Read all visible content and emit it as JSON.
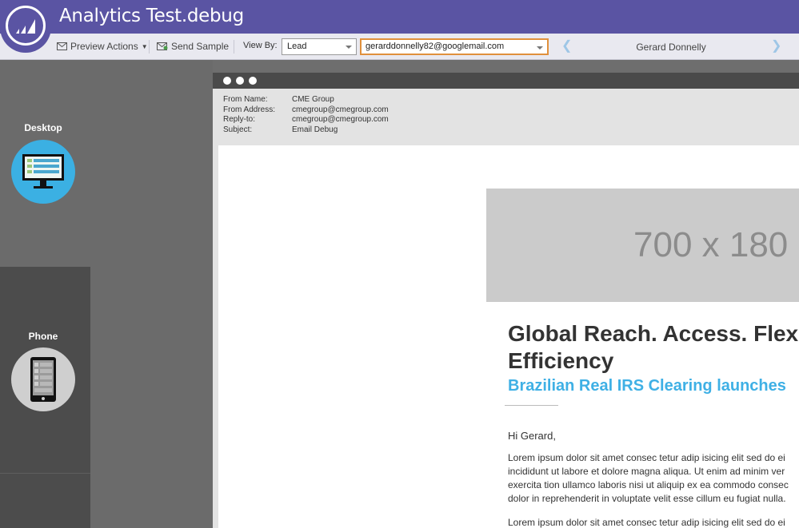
{
  "app": {
    "title": "Analytics Test.debug"
  },
  "toolbar": {
    "preview_actions": "Preview Actions",
    "send_sample": "Send Sample",
    "view_by_label": "View By:",
    "view_by_value": "Lead",
    "lead_email": "gerarddonnelly82@googlemail.com",
    "lead_name": "Gerard Donnelly"
  },
  "devices": {
    "desktop": "Desktop",
    "phone": "Phone"
  },
  "email": {
    "from_name_label": "From Name:",
    "from_name": "CME Group",
    "from_address_label": "From Address:",
    "from_address": "cmegroup@cmegroup.com",
    "reply_to_label": "Reply-to:",
    "reply_to": "cmegroup@cmegroup.com",
    "subject_label": "Subject:",
    "subject": "Email Debug",
    "hero_placeholder": "700 x 180",
    "headline_1": "Global Reach. Access. Flex",
    "headline_2": "Efficiency",
    "subheadline": "Brazilian Real IRS Clearing launches",
    "greeting": "Hi Gerard,",
    "body_lines": [
      "Lorem ipsum dolor sit amet consec tetur adip isicing elit sed do ei",
      "incididunt ut labore et dolore magna aliqua. Ut enim ad minim ver",
      "exercita tion ullamco laboris nisi ut aliquip ex ea commodo consec",
      "dolor in reprehenderit in voluptate velit esse cillum eu fugiat nulla."
    ],
    "body_line_2": "Lorem ipsum dolor sit amet consec tetur adip isicing elit sed do ei"
  },
  "colors": {
    "brand": "#5a54a3",
    "accent_blue": "#3fb0e5",
    "focus": "#e0903c"
  }
}
